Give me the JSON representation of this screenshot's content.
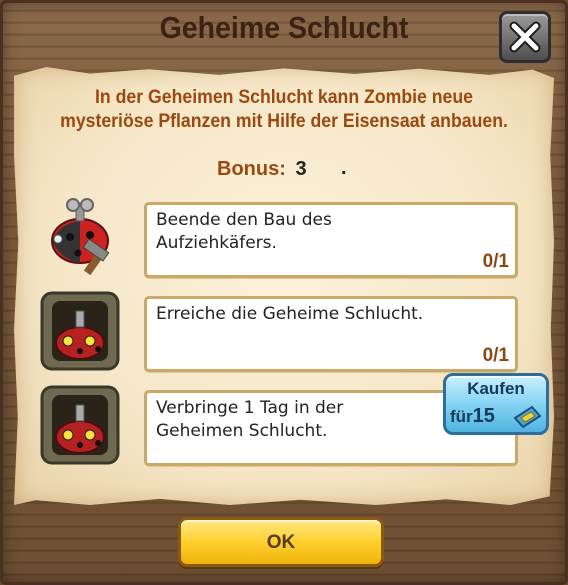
{
  "dialog": {
    "title": "Geheime Schlucht",
    "description": "In der Geheimen Schlucht kann Zombie neue mysteriöse Pflanzen mit Hilfe der Eisensaat anbauen.",
    "bonus_label": "Bonus:",
    "bonus_value": "3",
    "bonus_trailing": "."
  },
  "tasks": [
    {
      "text": "Beende den Bau des Aufziehkäfers.",
      "progress": "0/1",
      "icon": "windup-ladybug-hammer-icon"
    },
    {
      "text": "Erreiche die Geheime Schlucht.",
      "progress": "0/1",
      "icon": "ladybug-cave-icon"
    },
    {
      "text": "Verbringe 1 Tag in der Geheimen Schlucht.",
      "progress": "",
      "icon": "ladybug-cave-icon"
    }
  ],
  "buy_button": {
    "label": "Kaufen",
    "price_prefix": "für",
    "price": "15",
    "currency_icon": "ticket-icon"
  },
  "ok_button": {
    "label": "OK"
  },
  "colors": {
    "title": "#3b2414",
    "accent_text": "#9a4a10",
    "ok": "#ffcf2e",
    "buy": "#7fd0f2"
  }
}
